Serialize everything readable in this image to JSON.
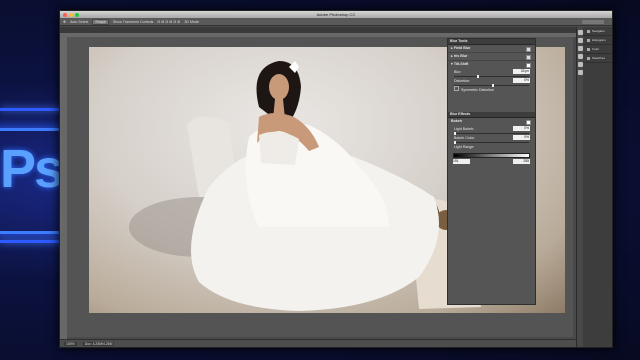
{
  "window": {
    "title": "Adobe Photoshop CC"
  },
  "options_bar": {
    "items": [
      "Auto Select",
      "Shape",
      "Show Transform Controls"
    ],
    "mode_label": "3D Mode"
  },
  "blur_tools": {
    "header": "Blur Tools",
    "field_blur": "Field Blur",
    "iris_blur": "Iris Blur",
    "tilt_shift": "Tilt-Shift",
    "blur_label": "Blur:",
    "blur_value": "33 px",
    "distortion_label": "Distortion:",
    "distortion_value": "0%",
    "symmetric_label": "Symmetric Distortion"
  },
  "blur_effects": {
    "header": "Blur Effects",
    "bokeh": "Bokeh",
    "light_bokeh_label": "Light Bokeh:",
    "light_bokeh_value": "0%",
    "bokeh_color_label": "Bokeh Color:",
    "bokeh_color_value": "0%",
    "light_range_label": "Light Range:",
    "range_low": "191",
    "range_high": "255"
  },
  "dock": {
    "items": [
      "Navigator",
      "Histogram",
      "Color",
      "Swatches"
    ]
  },
  "status_bar": {
    "zoom": "100%",
    "doc": "Doc: 4.25M/4.25M"
  },
  "colors": {
    "accent": "#2e5bff",
    "panel": "#555555"
  }
}
